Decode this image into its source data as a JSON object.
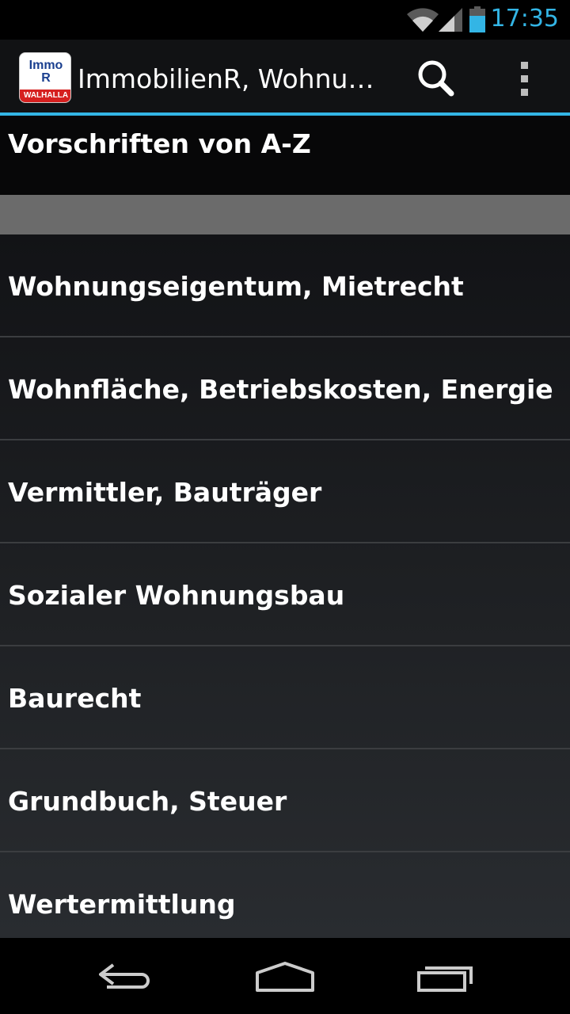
{
  "status_bar": {
    "time": "17:35",
    "icons": [
      "wifi-icon",
      "signal-icon",
      "battery-icon"
    ]
  },
  "action_bar": {
    "logo_line1": "Immo",
    "logo_line2": "R",
    "logo_band": "WALHALLA",
    "title": "ImmobilienR, Wohnun...",
    "actions": [
      "search-icon",
      "overflow-menu-icon"
    ]
  },
  "section": {
    "title": "Vorschriften von A-Z"
  },
  "list": {
    "items": [
      "Wohnungseigentum, Mietrecht",
      "Wohnfläche, Betriebskosten, Energie",
      "Vermittler, Bauträger",
      "Sozialer Wohnungsbau",
      "Baurecht",
      "Grundbuch, Steuer",
      "Wertermittlung"
    ]
  },
  "nav_bar": {
    "buttons": [
      "back-icon",
      "home-icon",
      "recent-apps-icon"
    ]
  },
  "colors": {
    "accent": "#33b5e5",
    "separator": "#6b6b6b"
  }
}
